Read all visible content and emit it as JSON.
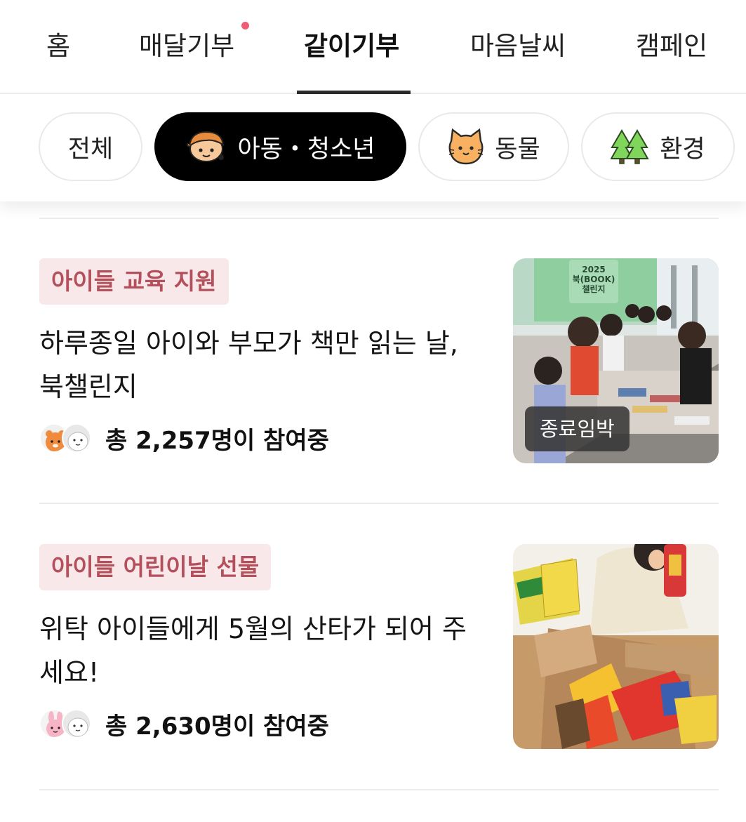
{
  "nav": {
    "tabs": [
      {
        "label": "홈"
      },
      {
        "label": "매달기부",
        "has_new_dot": true
      },
      {
        "label": "같이기부",
        "active": true
      },
      {
        "label": "마음날씨"
      },
      {
        "label": "캠페인"
      }
    ]
  },
  "filters": {
    "chips": [
      {
        "label": "전체",
        "icon": "none"
      },
      {
        "label": "아동・청소년",
        "icon": "child-icon",
        "active": true
      },
      {
        "label": "동물",
        "icon": "cat-icon"
      },
      {
        "label": "환경",
        "icon": "tree-icon"
      }
    ]
  },
  "fundraisers": [
    {
      "tag": "아이들 교육 지원",
      "title": "하루종일 아이와 부모가 책만 읽는 날, 북챌린지",
      "participants": "총 2,257명이 참여중",
      "badge": "종료임박",
      "image_text": {
        "year": "2025",
        "line1": "북(BOOK)",
        "line2": "챌린지"
      }
    },
    {
      "tag": "아이들 어린이날 선물",
      "title": "위탁 아이들에게 5월의 산타가 되어 주세요!",
      "participants": "총 2,630명이 참여중"
    }
  ],
  "colors": {
    "accent_dot": "#ef5b73",
    "tag_bg": "#f8e8e9",
    "tag_text": "#b3505c",
    "active_chip": "#000000"
  }
}
